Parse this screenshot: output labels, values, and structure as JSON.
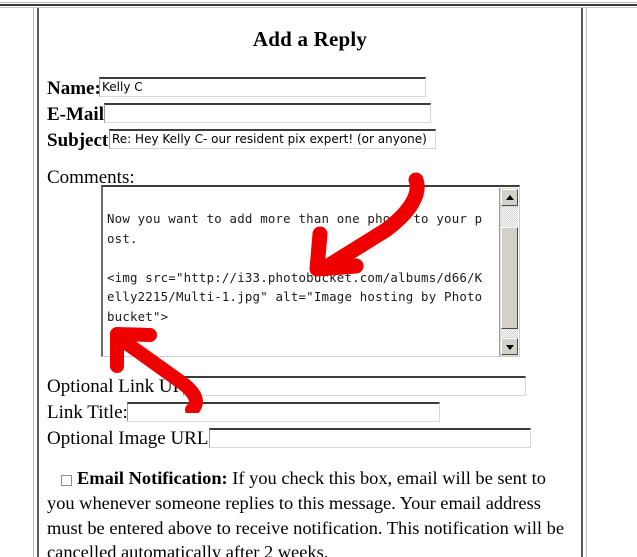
{
  "page": {
    "title": "Add a Reply"
  },
  "form": {
    "name": {
      "label": "Name:",
      "value": "Kelly C",
      "placeholder": ""
    },
    "email": {
      "label": "E-Mail:",
      "value": "",
      "placeholder": ""
    },
    "subject": {
      "label": "Subject:",
      "value": "Re: Hey Kelly C- our resident pix expert! (or anyone)",
      "placeholder": ""
    },
    "comments": {
      "label": "Comments:",
      "value": "Now you want to add more than one photo to your post.\n\n<img src=\"http://i33.photobucket.com/albums/d66/Kelly2215/Multi-1.jpg\" alt=\"Image hosting by Photobucket\">"
    },
    "link_url": {
      "label": "Optional Link URL:",
      "value": "",
      "placeholder": ""
    },
    "link_title": {
      "label": "Link Title:",
      "value": "",
      "placeholder": ""
    },
    "image_url": {
      "label": "Optional Image URL:",
      "value": "",
      "placeholder": ""
    },
    "email_notification": {
      "label": "Email Notification:",
      "checked": false,
      "description": "If you check this box, email will be sent to you whenever someone replies to this message. Your email address must be entered above to receive notification. This notification will be cancelled automatically after 2 weeks."
    }
  },
  "scrollbar": {
    "up_icon": "scroll-up-arrow",
    "down_icon": "scroll-down-arrow"
  },
  "annotations": {
    "color": "#EE0000",
    "arrow_upper": "red-arrow-pointing-down-left",
    "arrow_lower": "red-arrow-pointing-up-left"
  }
}
